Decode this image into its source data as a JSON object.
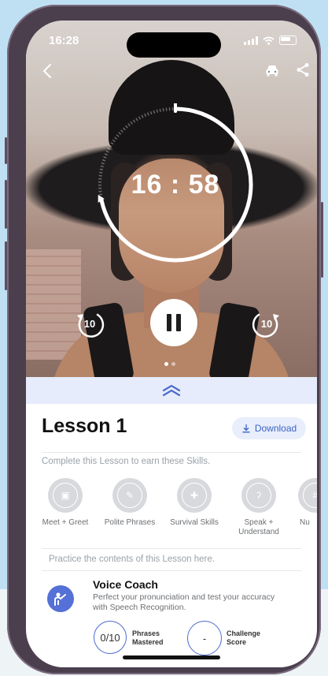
{
  "status_bar": {
    "time": "16:28"
  },
  "player": {
    "timer": "16 : 58",
    "progress_fraction": 0.72,
    "skip_back_label": "10",
    "skip_forward_label": "10"
  },
  "lesson": {
    "title": "Lesson 1",
    "download_label": "Download",
    "skills_hint": "Complete this Lesson to earn these Skills.",
    "skills": [
      {
        "label": "Meet + Greet",
        "icon": "chat-icon"
      },
      {
        "label": "Polite Phrases",
        "icon": "edit-icon"
      },
      {
        "label": "Survival Skills",
        "icon": "first-aid-icon"
      },
      {
        "label": "Speak + Understand",
        "icon": "ear-icon"
      },
      {
        "label": "Nu",
        "icon": "number-icon"
      }
    ],
    "practice_hint": "Practice the contents of this Lesson here."
  },
  "voice_coach": {
    "title": "Voice Coach",
    "description": "Perfect your pronunciation and test your accuracy with Speech Recognition.",
    "phrases_value": "0/10",
    "phrases_label": "Phrases Mastered",
    "challenge_value": "-",
    "challenge_label": "Challenge Score"
  },
  "colors": {
    "accent": "#4c6bd0",
    "sheet_tint": "#e6ecfb"
  }
}
